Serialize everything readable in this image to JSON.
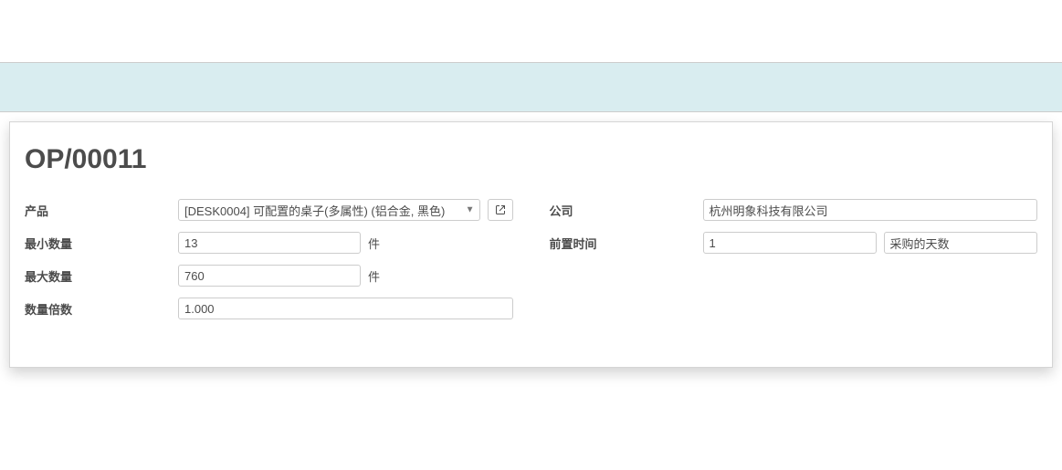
{
  "header": {
    "title": "OP/00011"
  },
  "left": {
    "product_label": "产品",
    "product_value": "[DESK0004] 可配置的桌子(多属性) (铝合金, 黑色)",
    "min_qty_label": "最小数量",
    "min_qty_value": "13",
    "min_qty_uom": "件",
    "max_qty_label": "最大数量",
    "max_qty_value": "760",
    "max_qty_uom": "件",
    "qty_multiple_label": "数量倍数",
    "qty_multiple_value": "1.000"
  },
  "right": {
    "company_label": "公司",
    "company_value": "杭州明象科技有限公司",
    "lead_time_label": "前置时间",
    "lead_time_value": "1",
    "lead_time_unit_value": "采购的天数"
  }
}
